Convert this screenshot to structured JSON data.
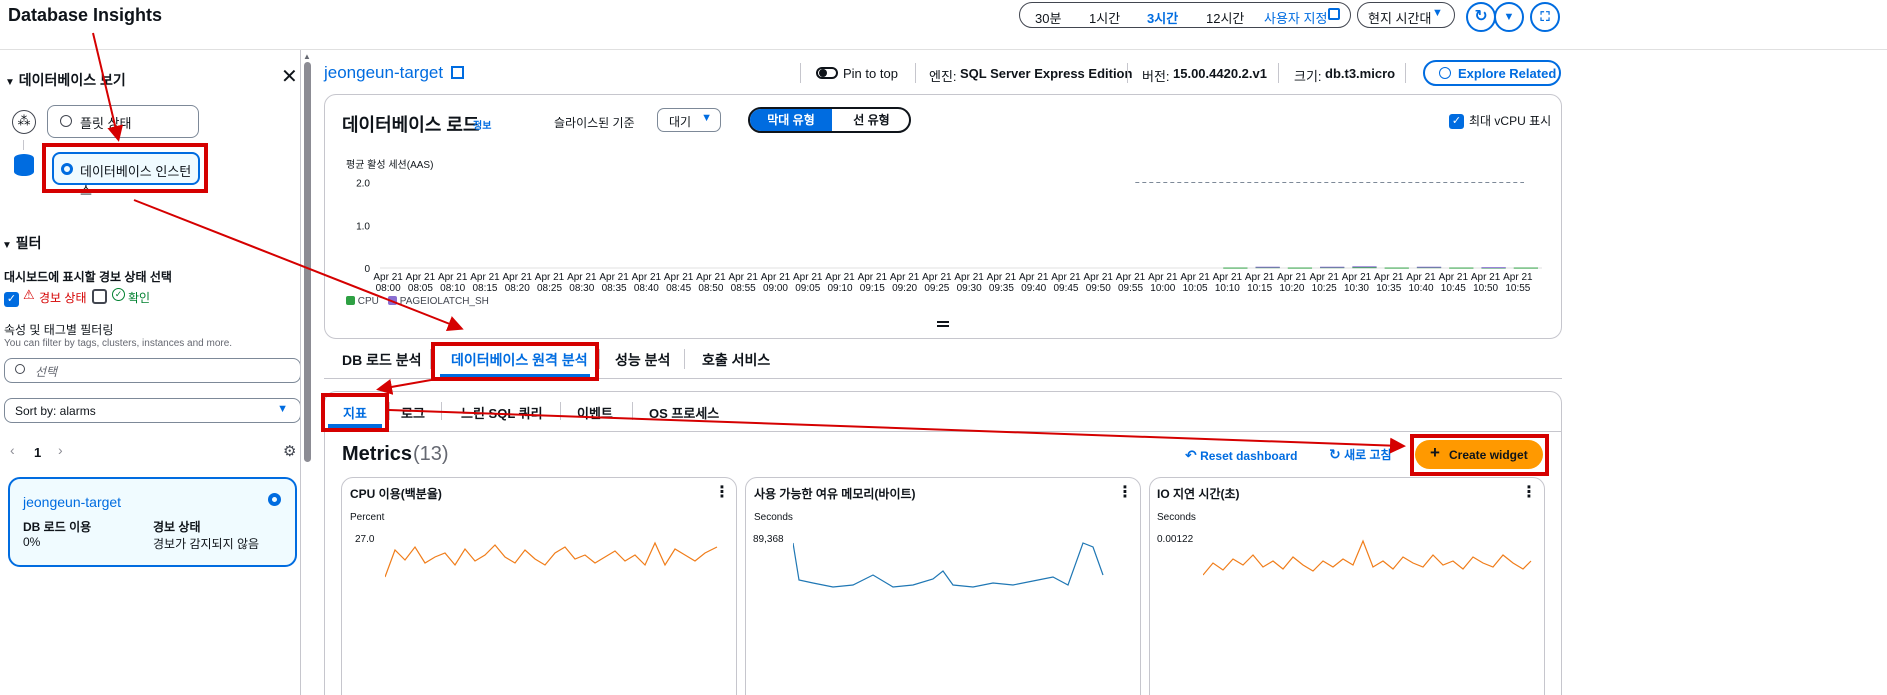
{
  "app": {
    "title": "Database Insights"
  },
  "time_range": {
    "options": [
      "30분",
      "1시간",
      "3시간",
      "12시간"
    ],
    "selected": "3시간",
    "custom": "사용자 지정",
    "timezone": "현지 시간대"
  },
  "sidebar": {
    "view_header": "데이터베이스 보기",
    "view_options": [
      "플릿 상태",
      "데이터베이스 인스턴스"
    ],
    "filter_header": "필터",
    "alarm_select_label": "대시보드에 표시할 경보 상태 선택",
    "alarm_state": "경보 상태",
    "ok_state": "확인",
    "attr_filter_title": "속성 및 태그별 필터링",
    "attr_filter_help": "You can filter by tags, clusters, instances and more.",
    "search_placeholder": "선택",
    "sort_label": "Sort by: alarms",
    "page_number": "1",
    "instance_card": {
      "name": "jeongeun-target",
      "load_label": "DB 로드 이용",
      "load_value": "0%",
      "alarm_label": "경보 상태",
      "alarm_value": "경보가 감지되지 않음"
    }
  },
  "header": {
    "instance_name": "jeongeun-target",
    "pin_label": "Pin to top",
    "engine_label": "엔진:",
    "engine_value": "SQL Server Express Edition",
    "version_label": "버전:",
    "version_value": "15.00.4420.2.v1",
    "size_label": "크기:",
    "size_value": "db.t3.micro",
    "explore_button": "Explore Related"
  },
  "db_load": {
    "title": "데이터베이스 로드",
    "info": "정보",
    "slice_label": "슬라이스된 기준",
    "slice_value": "대기",
    "chart_types": [
      "막대 유형",
      "선 유형"
    ],
    "chart_type_selected": "막대 유형",
    "max_vcpu_label": "최대 vCPU 표시",
    "y_axis_label": "평균 활성 세션(AAS)",
    "legend": [
      "CPU",
      "PAGEIOLATCH_SH"
    ]
  },
  "chart_data": {
    "type": "bar",
    "ylabel": "평균 활성 세션(AAS)",
    "y_ticks": [
      "2.0",
      "1.0",
      "0"
    ],
    "ylim": [
      0,
      2.2
    ],
    "max_vcpu": 2.0,
    "x_date": "Apr 21",
    "x_times": [
      "08:00",
      "08:05",
      "08:10",
      "08:15",
      "08:20",
      "08:25",
      "08:30",
      "08:35",
      "08:40",
      "08:45",
      "08:50",
      "08:55",
      "09:00",
      "09:05",
      "09:10",
      "09:15",
      "09:20",
      "09:25",
      "09:30",
      "09:35",
      "09:40",
      "09:45",
      "09:50",
      "09:55",
      "10:00",
      "10:05",
      "10:10",
      "10:15",
      "10:20",
      "10:25",
      "10:30",
      "10:35",
      "10:40",
      "10:45",
      "10:50",
      "10:55"
    ],
    "series": [
      {
        "name": "CPU",
        "color": "#2ea043",
        "values": [
          0,
          0,
          0,
          0,
          0,
          0,
          0,
          0,
          0,
          0,
          0,
          0,
          0,
          0,
          0,
          0,
          0,
          0,
          0,
          0,
          0,
          0,
          0,
          0,
          0,
          0,
          0.01,
          0.02,
          0.01,
          0.02,
          0.02,
          0.01,
          0.02,
          0.01,
          0.01,
          0.01
        ]
      },
      {
        "name": "PAGEIOLATCH_SH",
        "color": "#8a6fd1",
        "values": [
          0,
          0,
          0,
          0,
          0,
          0,
          0,
          0,
          0,
          0,
          0,
          0,
          0,
          0,
          0,
          0,
          0,
          0,
          0,
          0,
          0,
          0,
          0,
          0,
          0,
          0,
          0,
          0.01,
          0,
          0.01,
          0.02,
          0,
          0.01,
          0,
          0.01,
          0
        ]
      }
    ]
  },
  "analysis_tabs": [
    "DB 로드 분석",
    "데이터베이스 원격 분석",
    "성능 분석",
    "호출 서비스"
  ],
  "analysis_tab_selected": "데이터베이스 원격 분석",
  "sub_tabs": [
    "지표",
    "로그",
    "느린 SQL 쿼리",
    "이벤트",
    "OS 프로세스"
  ],
  "sub_tab_selected": "지표",
  "metrics": {
    "title": "Metrics",
    "count": "(13)",
    "reset": "Reset dashboard",
    "refresh": "새로 고침",
    "create": "Create widget",
    "widgets": [
      {
        "title": "CPU 이용(백분율)",
        "unit": "Percent",
        "tick": "27.0",
        "color": "#f07d1a"
      },
      {
        "title": "사용 가능한 여유 메모리(바이트)",
        "unit": "Seconds",
        "tick": "89,368",
        "color": "#1f77b4"
      },
      {
        "title": "IO 지연 시간(초)",
        "unit": "Seconds",
        "tick": "0.00122",
        "color": "#f07d1a"
      }
    ]
  },
  "colors": {
    "accent": "#006ce0",
    "annotation": "#d50000",
    "primary_button": "#ff9900"
  }
}
